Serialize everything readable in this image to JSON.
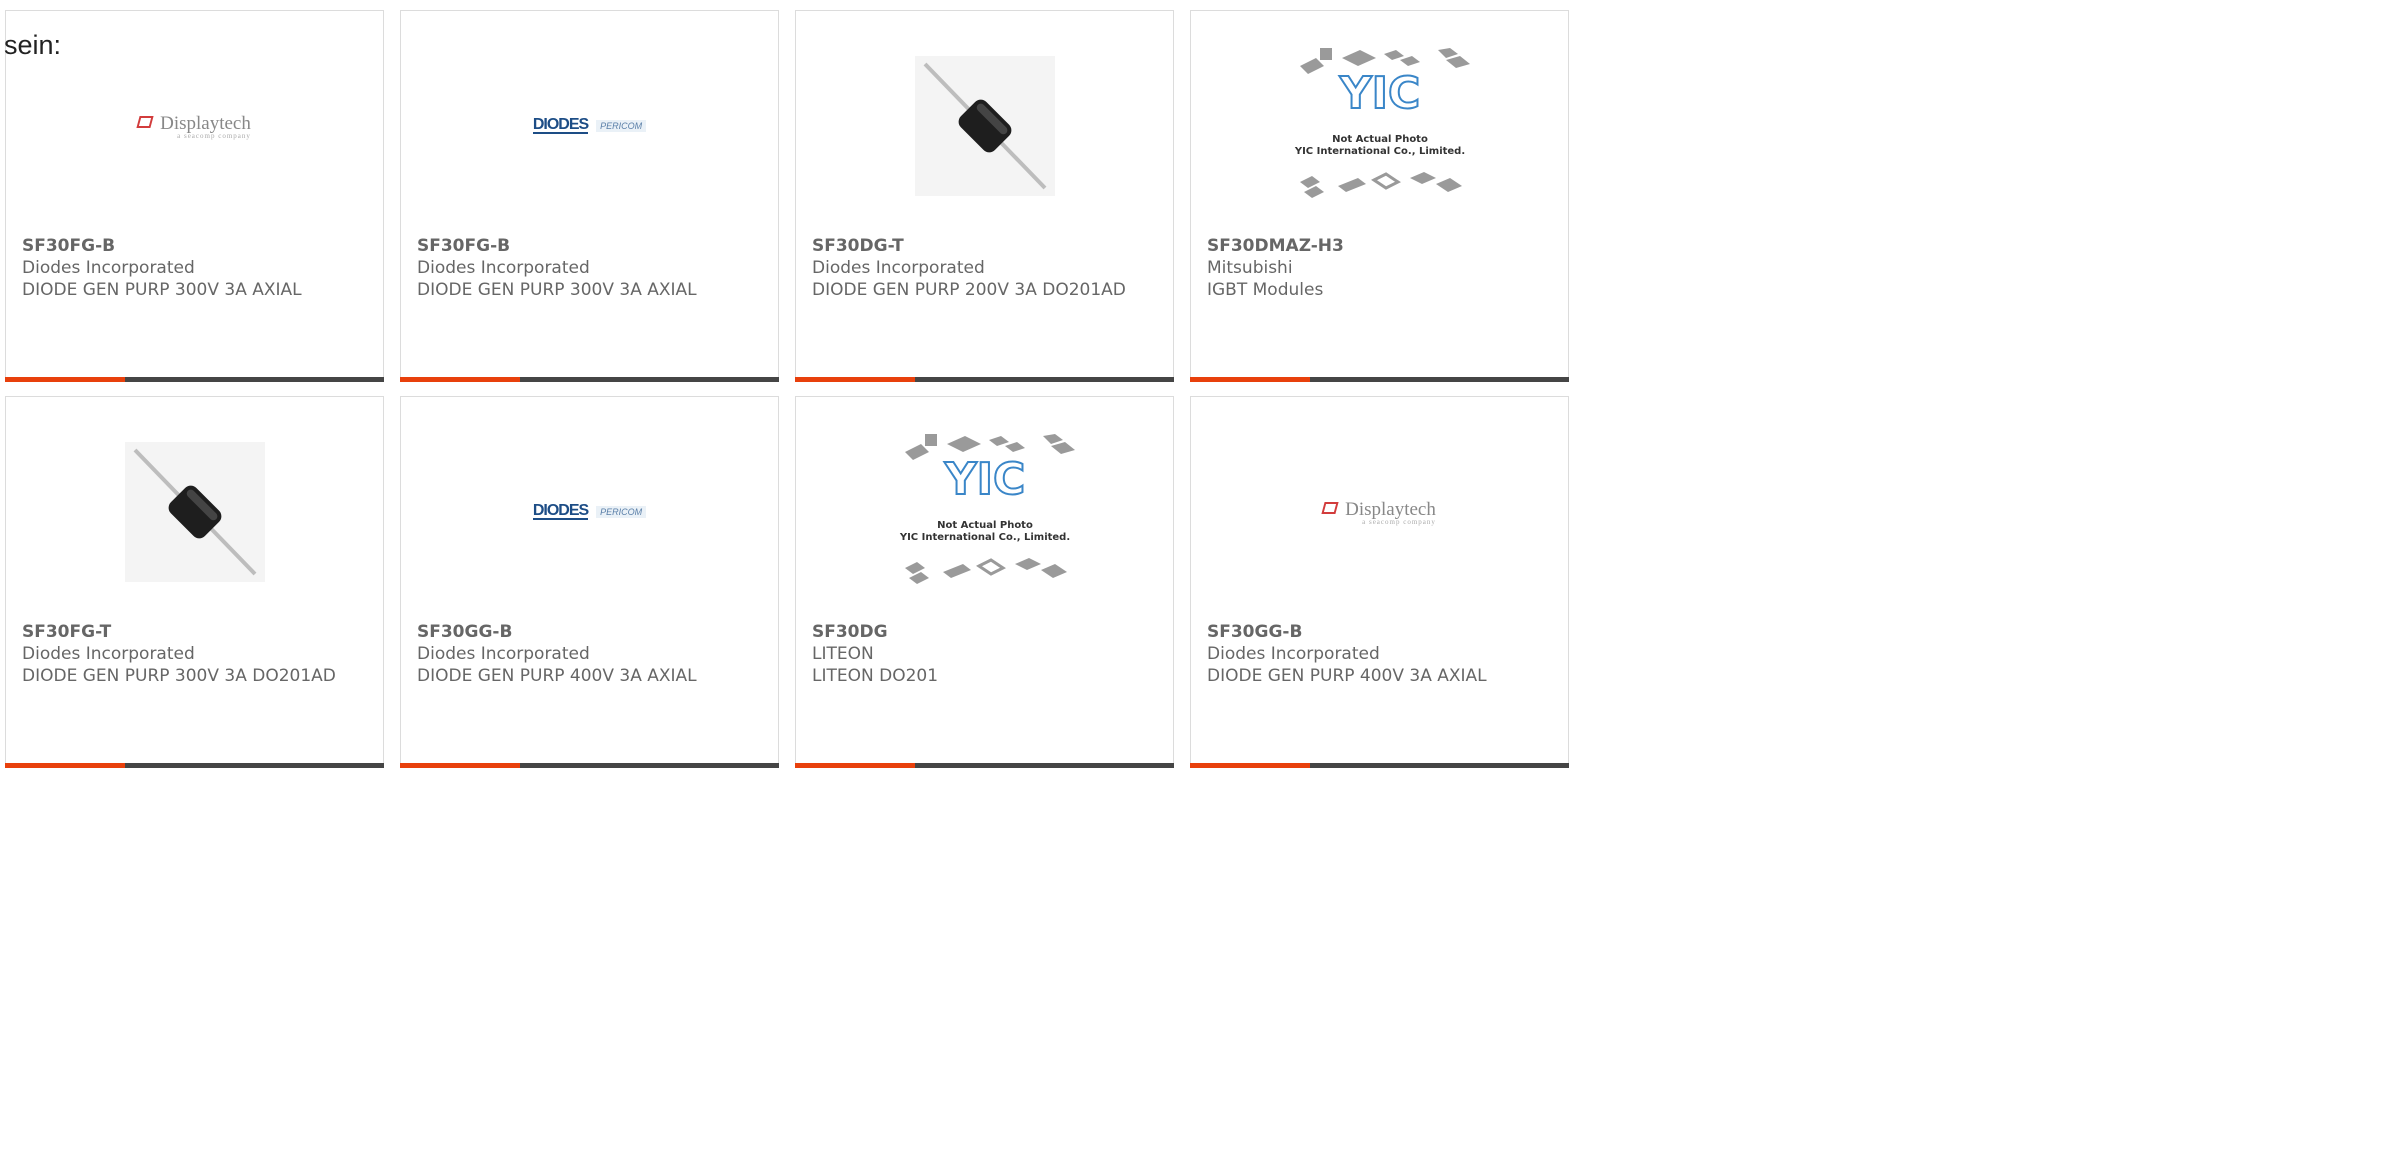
{
  "lead_text": "sein:",
  "colors": {
    "accent": "#e8400c",
    "bar_dark": "#454545",
    "text_gray": "#666666"
  },
  "logos": {
    "displaytech": {
      "name": "Displaytech",
      "tagline": "a seacomp company"
    },
    "diodes": {
      "name": "DIODES",
      "partner": "PERICOM"
    },
    "yic": {
      "mark": "YIC",
      "line1": "Not Actual Photo",
      "line2": "YIC International Co., Limited."
    }
  },
  "products": [
    {
      "part": "SF30FG-B",
      "maker": "Diodes Incorporated",
      "desc": "DIODE GEN PURP 300V 3A AXIAL",
      "image": "displaytech-logo"
    },
    {
      "part": "SF30FG-B",
      "maker": "Diodes Incorporated",
      "desc": "DIODE GEN PURP 300V 3A AXIAL",
      "image": "diodes-logo"
    },
    {
      "part": "SF30DG-T",
      "maker": "Diodes Incorporated",
      "desc": "DIODE GEN PURP 200V 3A DO201AD",
      "image": "axial-diode"
    },
    {
      "part": "SF30DMAZ-H3",
      "maker": "Mitsubishi",
      "desc": "IGBT Modules",
      "image": "yic-placeholder"
    },
    {
      "part": "SF30FG-T",
      "maker": "Diodes Incorporated",
      "desc": "DIODE GEN PURP 300V 3A DO201AD",
      "image": "axial-diode"
    },
    {
      "part": "SF30GG-B",
      "maker": "Diodes Incorporated",
      "desc": "DIODE GEN PURP 400V 3A AXIAL",
      "image": "diodes-logo"
    },
    {
      "part": "SF30DG",
      "maker": "LITEON",
      "desc": "LITEON DO201",
      "image": "yic-placeholder"
    },
    {
      "part": "SF30GG-B",
      "maker": "Diodes Incorporated",
      "desc": "DIODE GEN PURP 400V 3A AXIAL",
      "image": "displaytech-logo"
    }
  ]
}
